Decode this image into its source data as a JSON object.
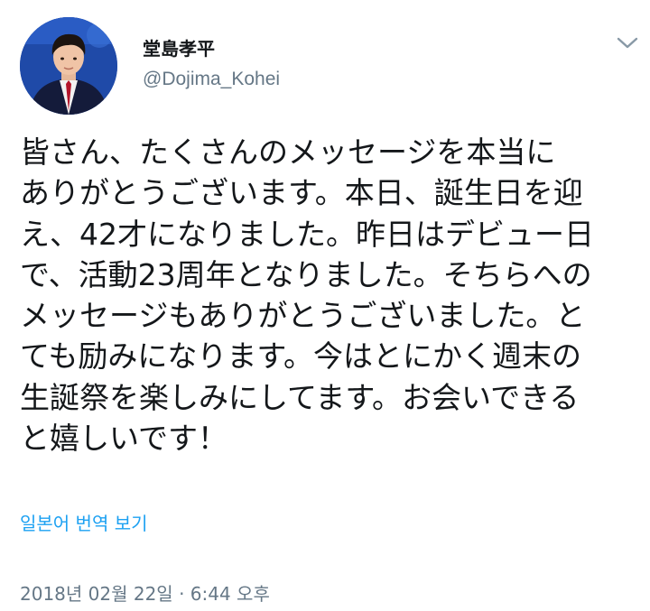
{
  "tweet": {
    "author": {
      "display_name": "堂島孝平",
      "handle": "@Dojima_Kohei",
      "avatar_icon": "profile-photo"
    },
    "more_icon": "chevron-down-icon",
    "lines": [
      "皆さん、たくさんのメッセージを本当に",
      "ありがとうございます。本日、誕生日を迎",
      "え、42才になりました。昨日はデビュー日",
      "で、活動23周年となりました。そちらへの",
      "メッセージもありがとうございました。と",
      "ても励みになります。今はとにかく週末の",
      "生誕祭を楽しみにしてます。お会いできる",
      "と嬉しいです！"
    ],
    "translate_label": "일본어 번역 보기",
    "timestamp": "2018년 02월 22일 · 6:44 오후"
  },
  "colors": {
    "text": "#14171a",
    "secondary": "#657786",
    "link": "#1da1f2",
    "background": "#ffffff"
  }
}
